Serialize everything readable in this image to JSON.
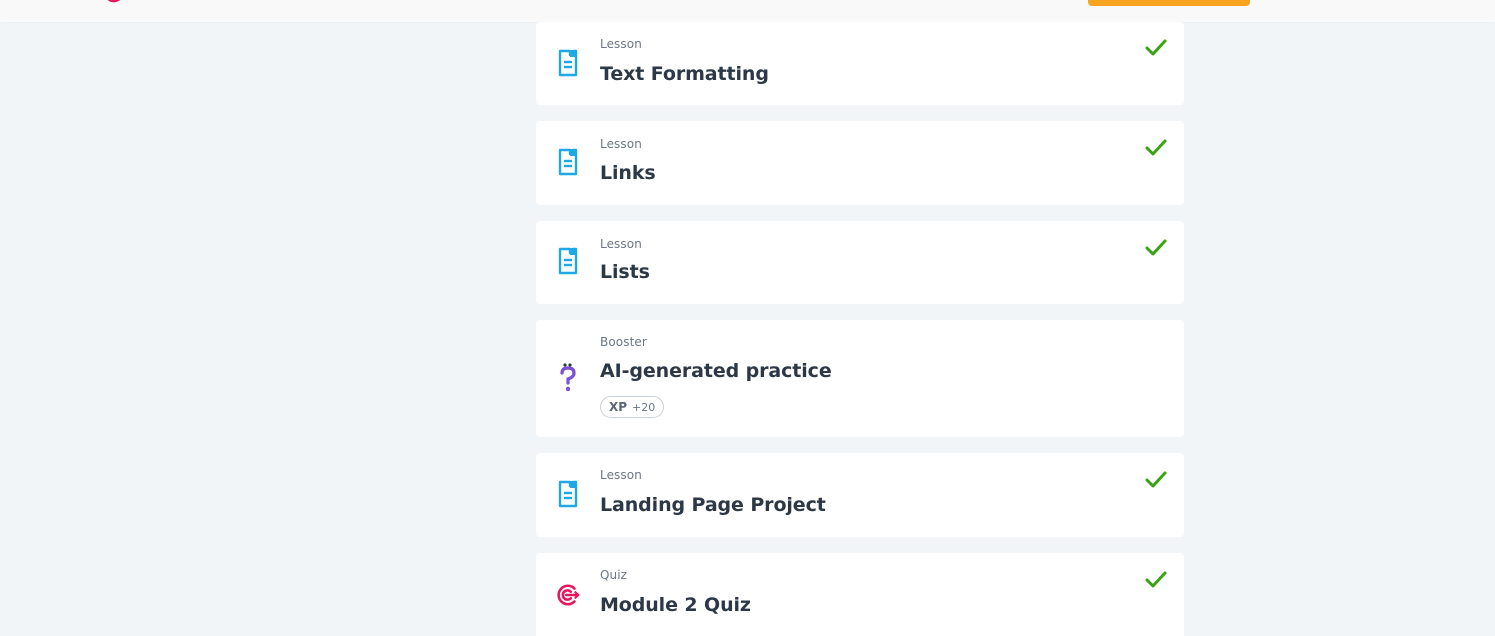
{
  "colors": {
    "page_bg": "#f2f5f7",
    "card_bg": "#ffffff",
    "lesson_icon": "#1ea8e6",
    "booster_icon": "#7b4fd6",
    "quiz_icon": "#e8175d",
    "check": "#3ca215",
    "cta": "#f7a51e",
    "title_text": "#2d3846",
    "meta_text": "#6b7785"
  },
  "items": [
    {
      "kind": "Lesson",
      "title": "Text Formatting",
      "icon": "lesson-document-icon",
      "completed": true
    },
    {
      "kind": "Lesson",
      "title": "Links",
      "icon": "lesson-document-icon",
      "completed": true
    },
    {
      "kind": "Lesson",
      "title": "Lists",
      "icon": "lesson-document-icon",
      "completed": true
    },
    {
      "kind": "Booster",
      "title": "AI-generated practice",
      "icon": "booster-question-icon",
      "completed": false,
      "xp": {
        "label": "XP",
        "value": "+20"
      }
    },
    {
      "kind": "Lesson",
      "title": "Landing Page Project",
      "icon": "lesson-document-icon",
      "completed": true
    },
    {
      "kind": "Quiz",
      "title": "Module 2 Quiz",
      "icon": "quiz-target-icon",
      "completed": true
    }
  ]
}
